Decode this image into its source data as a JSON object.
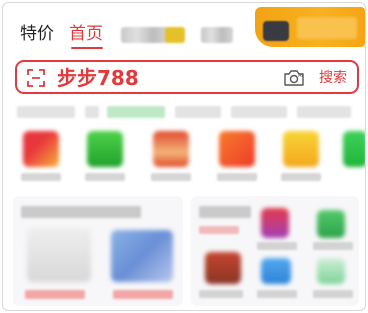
{
  "tabs": {
    "special": "特价",
    "home": "首页"
  },
  "search": {
    "value": "步步788",
    "button_label": "搜索"
  },
  "colors": {
    "accent": "#e4393c",
    "promo": "#f5a414"
  },
  "icons": {
    "scan": "scan-icon",
    "camera": "camera-ai-icon"
  }
}
